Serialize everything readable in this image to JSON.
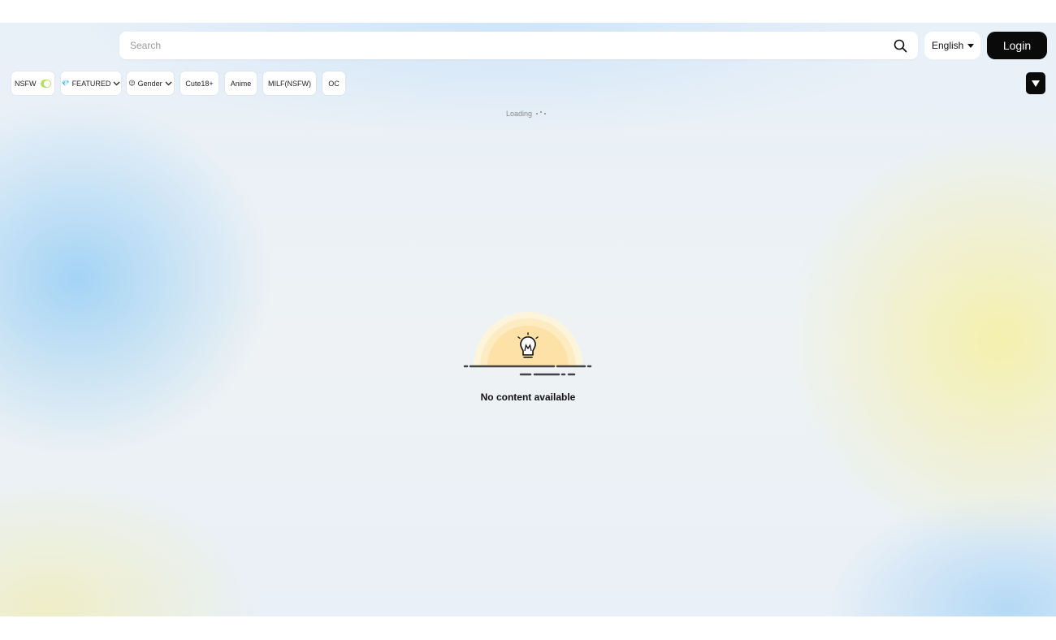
{
  "header": {
    "search": {
      "placeholder": "Search",
      "value": ""
    },
    "language": {
      "selected": "English"
    },
    "login_label": "Login"
  },
  "filters": {
    "nsfw": {
      "label": "NSFW",
      "enabled": true
    },
    "featured": {
      "icon": "💎",
      "label": "FEATURED"
    },
    "gender": {
      "icon": "😉",
      "label": "Gender"
    },
    "tags": [
      "Cute18+",
      "Anime",
      "MILF(NSFW)",
      "OC"
    ]
  },
  "status": {
    "loading_text": "Loading",
    "empty_text": "No content available"
  },
  "colors": {
    "accent": "#0a0a0a",
    "toggle_on": "#b8e060",
    "sun": "#fde7b0"
  },
  "icons": {
    "search": "search-icon",
    "language_caret": "caret-down-icon",
    "dropdown": "chevron-down-icon",
    "filter_toggle": "triangle-down-icon",
    "empty": "lightbulb-icon"
  }
}
